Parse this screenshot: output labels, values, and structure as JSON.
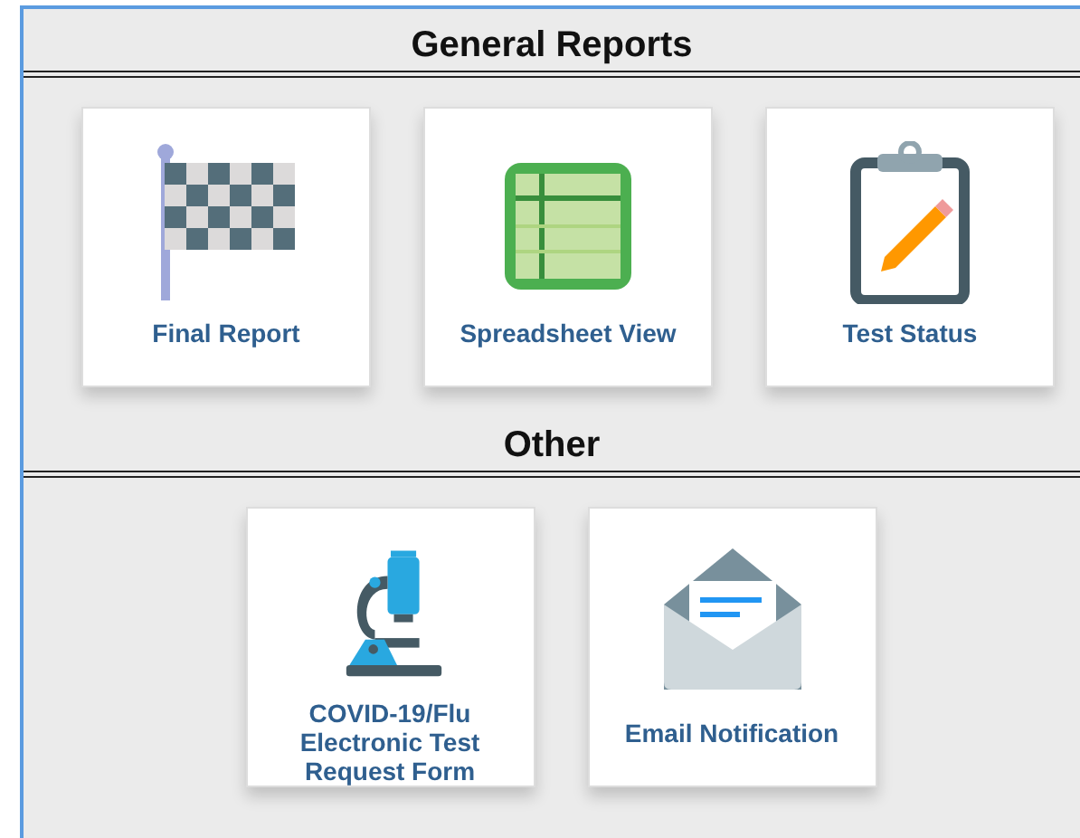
{
  "sections": [
    {
      "title": "General Reports",
      "tiles": [
        {
          "label": "Final Report",
          "kind": "flag"
        },
        {
          "label": "Spreadsheet View",
          "kind": "spreadsheet"
        },
        {
          "label": "Test Status",
          "kind": "clipboard"
        }
      ]
    },
    {
      "title": "Other",
      "tiles": [
        {
          "label": "COVID-19/Flu Electronic Test Request Form",
          "kind": "microscope"
        },
        {
          "label": "Email Notification",
          "kind": "envelope"
        }
      ]
    }
  ]
}
